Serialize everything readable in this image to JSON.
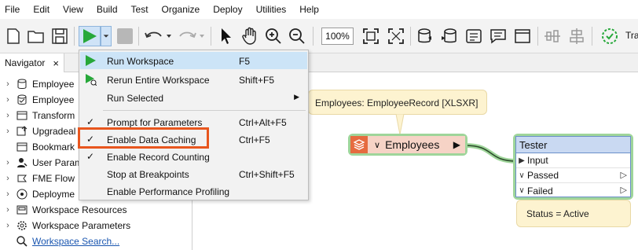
{
  "menubar": {
    "items": [
      "File",
      "Edit",
      "View",
      "Build",
      "Test",
      "Organize",
      "Deploy",
      "Utilities",
      "Help"
    ]
  },
  "toolbar": {
    "zoom": "100%",
    "truncated_label": "Tra",
    "icons": [
      "new-icon",
      "open-icon",
      "save-icon",
      "run-icon",
      "run-dropdown-icon",
      "stop-icon",
      "undo-icon",
      "redo-icon",
      "select-pointer-icon",
      "pan-hand-icon",
      "zoom-in-icon",
      "zoom-out-icon",
      "zoom-to-fit-icon",
      "zoom-selection-icon",
      "add-reader-icon",
      "add-writer-icon",
      "add-transformer-icon",
      "annotation-icon",
      "bookmark-icon",
      "align-horizontal-icon",
      "align-vertical-icon",
      "status-icon"
    ],
    "accent": "#27a83a"
  },
  "navigator": {
    "tab_label": "Navigator",
    "close_glyph": "×",
    "items": [
      {
        "label": "Employee",
        "icon": "reader-icon"
      },
      {
        "label": "Employee",
        "icon": "writer-icon"
      },
      {
        "label": "Transform",
        "icon": "transformer-icon"
      },
      {
        "label": "Upgradeal",
        "icon": "upgrade-icon"
      },
      {
        "label": "Bookmark",
        "icon": "bookmark-icon"
      },
      {
        "label": "User Param",
        "icon": "user-parameter-icon"
      },
      {
        "label": "FME Flow",
        "icon": "flow-icon"
      },
      {
        "label": "Deployme",
        "icon": "deployment-icon"
      },
      {
        "label": "Workspace Resources",
        "icon": "resources-icon"
      },
      {
        "label": "Workspace Parameters",
        "icon": "parameters-icon"
      }
    ],
    "search_link": "Workspace Search..."
  },
  "run_menu": {
    "items": [
      {
        "label": "Run Workspace",
        "shortcut": "F5",
        "icon": "run-icon",
        "highlighted": true
      },
      {
        "label": "Rerun Entire Workspace",
        "shortcut": "Shift+F5",
        "icon": "rerun-icon"
      },
      {
        "label": "Run Selected",
        "shortcut": "",
        "submenu": "▶"
      },
      {
        "label": "Prompt for Parameters",
        "shortcut": "Ctrl+Alt+F5",
        "checked": true
      },
      {
        "label": "Enable Data Caching",
        "shortcut": "Ctrl+F5",
        "checked": true
      },
      {
        "label": "Enable Record Counting",
        "shortcut": "",
        "checked": true
      },
      {
        "label": "Stop at Breakpoints",
        "shortcut": "Ctrl+Shift+F5"
      },
      {
        "label": "Enable Performance Profiling",
        "shortcut": ""
      }
    ],
    "check_glyph": "✓",
    "focus_color": "#e8561e"
  },
  "canvas": {
    "annotation_reader": "Employees: EmployeeRecord [XLSXR]",
    "reader": {
      "label": "Employees",
      "port": "▶"
    },
    "tester": {
      "title": "Tester",
      "input_port": "Input",
      "output_ports": [
        "Passed",
        "Failed"
      ]
    },
    "annotation_status": "Status = Active"
  }
}
